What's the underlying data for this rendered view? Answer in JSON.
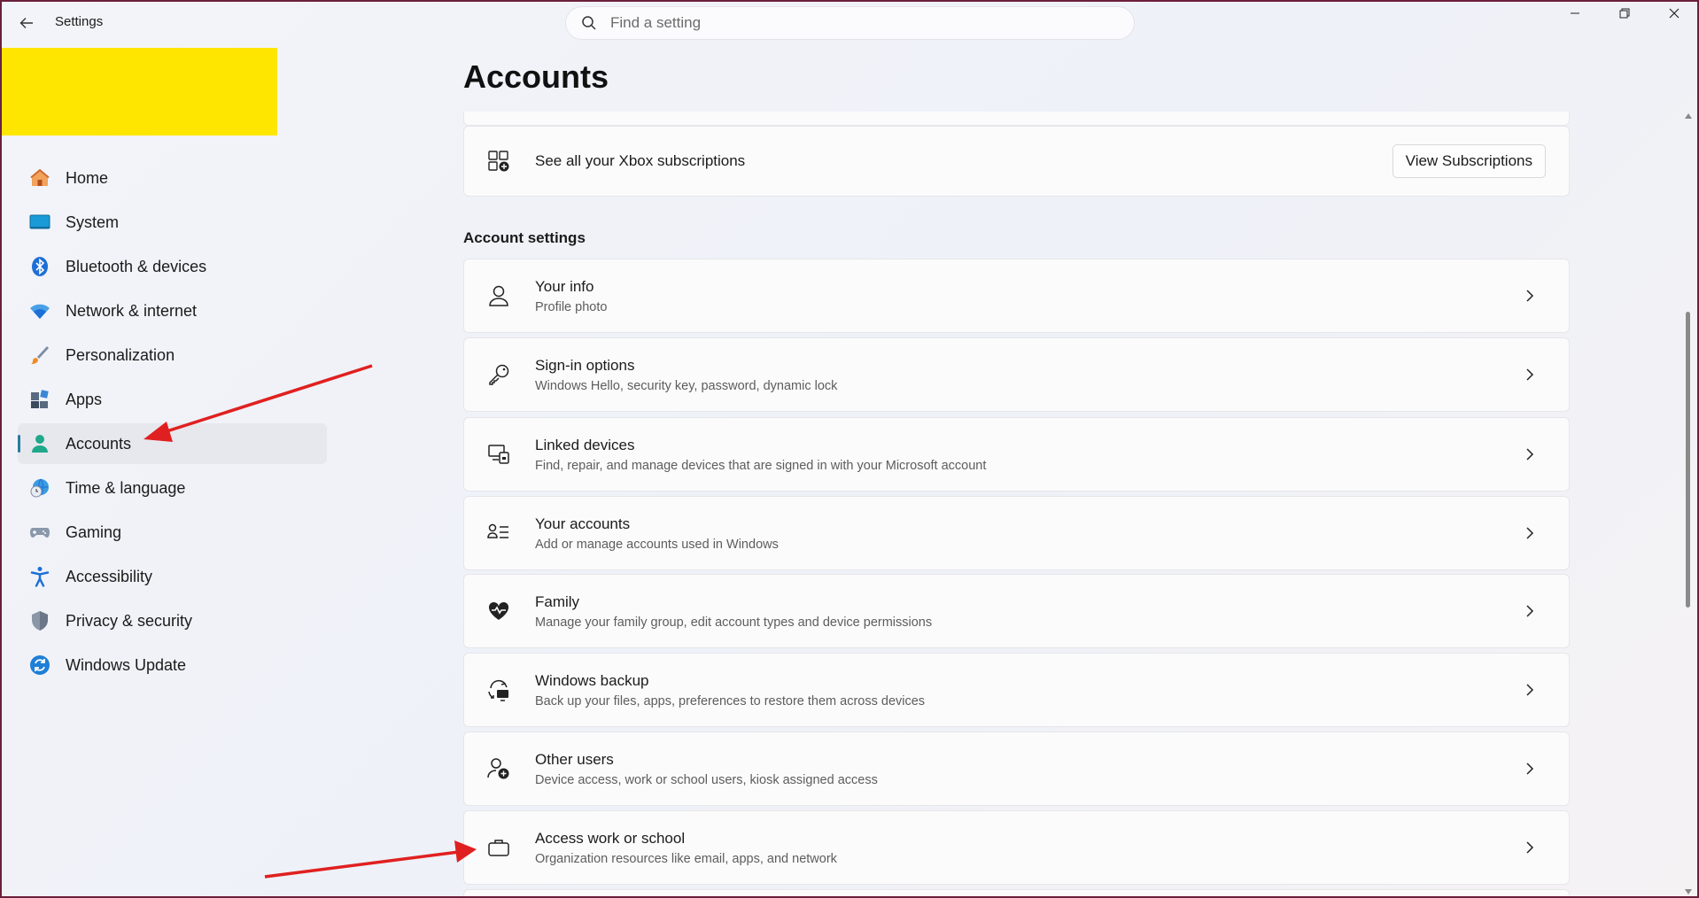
{
  "window": {
    "title": "Settings",
    "controls": [
      "minimize-icon",
      "restore-icon",
      "close-icon"
    ]
  },
  "search": {
    "placeholder": "Find a setting",
    "value": ""
  },
  "sidebar": {
    "items": [
      {
        "label": "Home",
        "icon": "home-icon"
      },
      {
        "label": "System",
        "icon": "system-icon"
      },
      {
        "label": "Bluetooth & devices",
        "icon": "bluetooth-icon"
      },
      {
        "label": "Network & internet",
        "icon": "wifi-icon"
      },
      {
        "label": "Personalization",
        "icon": "brush-icon"
      },
      {
        "label": "Apps",
        "icon": "apps-icon"
      },
      {
        "label": "Accounts",
        "icon": "accounts-icon",
        "selected": true
      },
      {
        "label": "Time & language",
        "icon": "globe-clock-icon"
      },
      {
        "label": "Gaming",
        "icon": "gamepad-icon"
      },
      {
        "label": "Accessibility",
        "icon": "accessibility-icon"
      },
      {
        "label": "Privacy & security",
        "icon": "shield-icon"
      },
      {
        "label": "Windows Update",
        "icon": "update-icon"
      }
    ]
  },
  "main": {
    "title": "Accounts",
    "xbox": {
      "title": "See all your Xbox subscriptions",
      "button": "View Subscriptions"
    },
    "section_title": "Account settings",
    "cards": [
      {
        "title": "Your info",
        "subtitle": "Profile photo",
        "icon": "person-icon"
      },
      {
        "title": "Sign-in options",
        "subtitle": "Windows Hello, security key, password, dynamic lock",
        "icon": "key-icon"
      },
      {
        "title": "Linked devices",
        "subtitle": "Find, repair, and manage devices that are signed in with your Microsoft account",
        "icon": "linked-devices-icon"
      },
      {
        "title": "Your accounts",
        "subtitle": "Add or manage accounts used in Windows",
        "icon": "accounts-list-icon"
      },
      {
        "title": "Family",
        "subtitle": "Manage your family group, edit account types and device permissions",
        "icon": "family-heart-icon"
      },
      {
        "title": "Windows backup",
        "subtitle": "Back up your files, apps, preferences to restore them across devices",
        "icon": "backup-icon"
      },
      {
        "title": "Other users",
        "subtitle": "Device access, work or school users, kiosk assigned access",
        "icon": "add-user-icon"
      },
      {
        "title": "Access work or school",
        "subtitle": "Organization resources like email, apps, and network",
        "icon": "briefcase-icon"
      }
    ]
  },
  "colors": {
    "accent": "#2a7a9e",
    "annotation_arrow": "#e02020",
    "redaction": "#ffe600"
  }
}
